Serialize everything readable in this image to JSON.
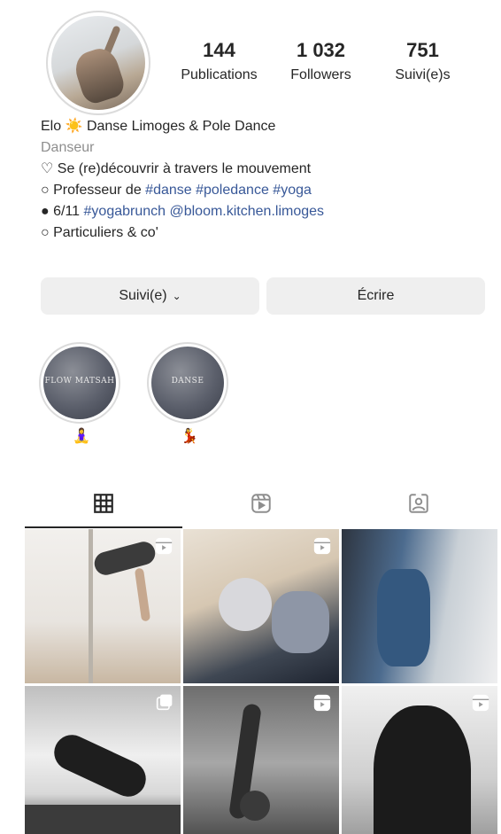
{
  "profile": {
    "stats": [
      {
        "value": "144",
        "label": "Publications"
      },
      {
        "value": "1 032",
        "label": "Followers"
      },
      {
        "value": "751",
        "label": "Suivi(e)s"
      }
    ],
    "bio": {
      "name": "Elo ☀️ Danse Limoges & Pole Dance",
      "category": "Danseur",
      "line1": "♡ Se (re)découvrir à travers le mouvement",
      "line2_prefix": "○ Professeur de ",
      "line2_tags": "#danse #poledance #yoga",
      "line3_prefix": "● 6/11 ",
      "line3_tags": "#yogabrunch @bloom.kitchen.limoges",
      "line4": "○ Particuliers & co'"
    }
  },
  "buttons": {
    "following_label": "Suivi(e)",
    "following_chevron": "⌄",
    "message_label": "Écrire"
  },
  "highlights": [
    {
      "cover_text": "FLOW MATSAH",
      "emoji": "🧘‍♀️"
    },
    {
      "cover_text": "DANSE",
      "emoji": "💃"
    }
  ],
  "tabs": [
    {
      "icon": "grid-icon",
      "active": true
    },
    {
      "icon": "reels-icon",
      "active": false
    },
    {
      "icon": "tagged-icon",
      "active": false
    }
  ],
  "posts": [
    {
      "type": "reel"
    },
    {
      "type": "reel"
    },
    {
      "type": "photo"
    },
    {
      "type": "multi"
    },
    {
      "type": "reel"
    },
    {
      "type": "reel"
    }
  ],
  "colors": {
    "text": "#262626",
    "secondary": "#8e8e8e",
    "link": "#385898",
    "button_bg": "#efefef"
  }
}
